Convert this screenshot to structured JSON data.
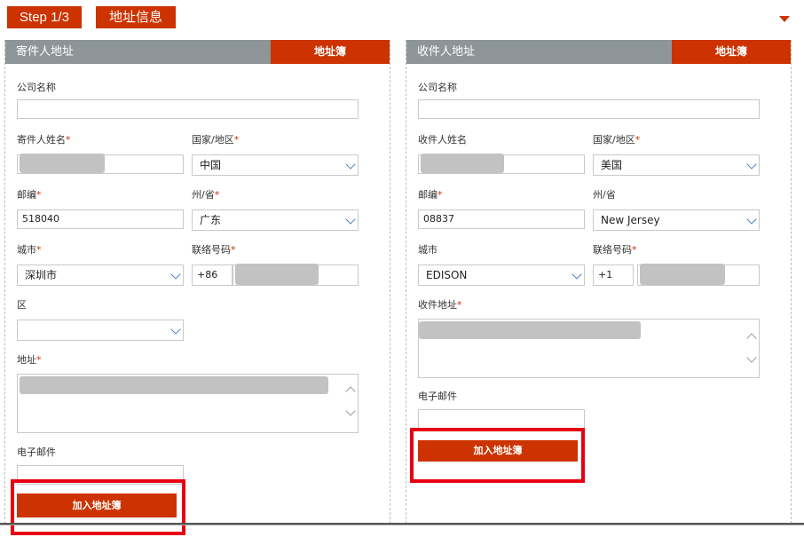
{
  "header": {
    "step_label": "Step 1/3",
    "title": "地址信息",
    "collapse_icon": "caret-down-icon"
  },
  "sender": {
    "heading": "寄件人地址",
    "address_book_label": "地址簿",
    "company_label": "公司名称",
    "company_value": "",
    "name_label": "寄件人姓名",
    "country_label": "国家/地区",
    "country_value": "中国",
    "postcode_label": "邮编",
    "postcode_value": "518040",
    "state_label": "州/省",
    "state_value": "广东",
    "city_label": "城市",
    "city_value": "深圳市",
    "phone_label": "联络号码",
    "phone_code": "+86",
    "district_label": "区",
    "district_value": "",
    "address_label": "地址",
    "email_label": "电子邮件",
    "email_value": "",
    "add_button": "加入地址簿"
  },
  "recipient": {
    "heading": "收件人地址",
    "address_book_label": "地址簿",
    "company_label": "公司名称",
    "company_value": "",
    "name_label": "收件人姓名",
    "country_label": "国家/地区",
    "country_value": "美国",
    "postcode_label": "邮编",
    "postcode_value": "08837",
    "state_label": "州/省",
    "state_value": "New Jersey",
    "city_label": "城市",
    "city_value": "EDISON",
    "phone_label": "联络号码",
    "phone_code": "+1",
    "address_label": "收件地址",
    "email_label": "电子邮件",
    "email_value": "",
    "add_button": "加入地址簿"
  },
  "colors": {
    "accent": "#cc3300",
    "panel_header": "#8d9598",
    "highlight": "#e60012",
    "redaction": "#c2c2c2"
  }
}
